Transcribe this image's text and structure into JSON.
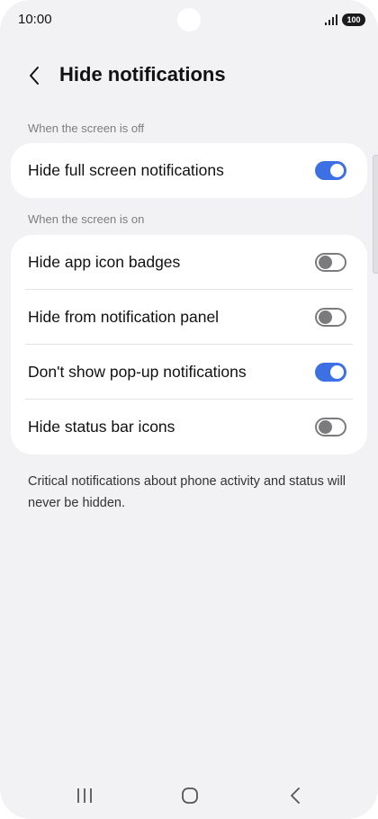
{
  "status_bar": {
    "time": "10:00",
    "battery": "100",
    "signal_icon": "signal-bars-icon"
  },
  "header": {
    "back_icon": "chevron-left-icon",
    "title": "Hide notifications"
  },
  "sections": [
    {
      "label": "When the screen is off",
      "items": [
        {
          "label": "Hide full screen notifications",
          "enabled": true
        }
      ]
    },
    {
      "label": "When the screen is on",
      "items": [
        {
          "label": "Hide app icon badges",
          "enabled": false
        },
        {
          "label": "Hide from notification panel",
          "enabled": false
        },
        {
          "label": "Don't show pop-up notifications",
          "enabled": true
        },
        {
          "label": "Hide status bar icons",
          "enabled": false
        }
      ]
    }
  ],
  "footnote": "Critical notifications about phone activity and status will never be hidden.",
  "nav_bar": {
    "recents_icon": "recents-icon",
    "home_icon": "home-icon",
    "back_icon": "back-icon"
  },
  "colors": {
    "accent": "#3e70e5",
    "background": "#f2f2f4",
    "card": "#ffffff",
    "toggle_off": "#7b7b7e"
  }
}
